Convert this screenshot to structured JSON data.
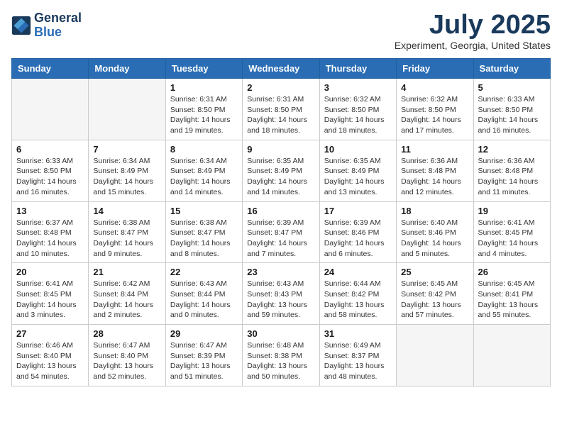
{
  "header": {
    "logo_line1": "General",
    "logo_line2": "Blue",
    "month": "July 2025",
    "location": "Experiment, Georgia, United States"
  },
  "days_of_week": [
    "Sunday",
    "Monday",
    "Tuesday",
    "Wednesday",
    "Thursday",
    "Friday",
    "Saturday"
  ],
  "weeks": [
    [
      {
        "day": "",
        "info": ""
      },
      {
        "day": "",
        "info": ""
      },
      {
        "day": "1",
        "sunrise": "6:31 AM",
        "sunset": "8:50 PM",
        "daylight": "14 hours and 19 minutes."
      },
      {
        "day": "2",
        "sunrise": "6:31 AM",
        "sunset": "8:50 PM",
        "daylight": "14 hours and 18 minutes."
      },
      {
        "day": "3",
        "sunrise": "6:32 AM",
        "sunset": "8:50 PM",
        "daylight": "14 hours and 18 minutes."
      },
      {
        "day": "4",
        "sunrise": "6:32 AM",
        "sunset": "8:50 PM",
        "daylight": "14 hours and 17 minutes."
      },
      {
        "day": "5",
        "sunrise": "6:33 AM",
        "sunset": "8:50 PM",
        "daylight": "14 hours and 16 minutes."
      }
    ],
    [
      {
        "day": "6",
        "sunrise": "6:33 AM",
        "sunset": "8:50 PM",
        "daylight": "14 hours and 16 minutes."
      },
      {
        "day": "7",
        "sunrise": "6:34 AM",
        "sunset": "8:49 PM",
        "daylight": "14 hours and 15 minutes."
      },
      {
        "day": "8",
        "sunrise": "6:34 AM",
        "sunset": "8:49 PM",
        "daylight": "14 hours and 14 minutes."
      },
      {
        "day": "9",
        "sunrise": "6:35 AM",
        "sunset": "8:49 PM",
        "daylight": "14 hours and 14 minutes."
      },
      {
        "day": "10",
        "sunrise": "6:35 AM",
        "sunset": "8:49 PM",
        "daylight": "14 hours and 13 minutes."
      },
      {
        "day": "11",
        "sunrise": "6:36 AM",
        "sunset": "8:48 PM",
        "daylight": "14 hours and 12 minutes."
      },
      {
        "day": "12",
        "sunrise": "6:36 AM",
        "sunset": "8:48 PM",
        "daylight": "14 hours and 11 minutes."
      }
    ],
    [
      {
        "day": "13",
        "sunrise": "6:37 AM",
        "sunset": "8:48 PM",
        "daylight": "14 hours and 10 minutes."
      },
      {
        "day": "14",
        "sunrise": "6:38 AM",
        "sunset": "8:47 PM",
        "daylight": "14 hours and 9 minutes."
      },
      {
        "day": "15",
        "sunrise": "6:38 AM",
        "sunset": "8:47 PM",
        "daylight": "14 hours and 8 minutes."
      },
      {
        "day": "16",
        "sunrise": "6:39 AM",
        "sunset": "8:47 PM",
        "daylight": "14 hours and 7 minutes."
      },
      {
        "day": "17",
        "sunrise": "6:39 AM",
        "sunset": "8:46 PM",
        "daylight": "14 hours and 6 minutes."
      },
      {
        "day": "18",
        "sunrise": "6:40 AM",
        "sunset": "8:46 PM",
        "daylight": "14 hours and 5 minutes."
      },
      {
        "day": "19",
        "sunrise": "6:41 AM",
        "sunset": "8:45 PM",
        "daylight": "14 hours and 4 minutes."
      }
    ],
    [
      {
        "day": "20",
        "sunrise": "6:41 AM",
        "sunset": "8:45 PM",
        "daylight": "14 hours and 3 minutes."
      },
      {
        "day": "21",
        "sunrise": "6:42 AM",
        "sunset": "8:44 PM",
        "daylight": "14 hours and 2 minutes."
      },
      {
        "day": "22",
        "sunrise": "6:43 AM",
        "sunset": "8:44 PM",
        "daylight": "14 hours and 0 minutes."
      },
      {
        "day": "23",
        "sunrise": "6:43 AM",
        "sunset": "8:43 PM",
        "daylight": "13 hours and 59 minutes."
      },
      {
        "day": "24",
        "sunrise": "6:44 AM",
        "sunset": "8:42 PM",
        "daylight": "13 hours and 58 minutes."
      },
      {
        "day": "25",
        "sunrise": "6:45 AM",
        "sunset": "8:42 PM",
        "daylight": "13 hours and 57 minutes."
      },
      {
        "day": "26",
        "sunrise": "6:45 AM",
        "sunset": "8:41 PM",
        "daylight": "13 hours and 55 minutes."
      }
    ],
    [
      {
        "day": "27",
        "sunrise": "6:46 AM",
        "sunset": "8:40 PM",
        "daylight": "13 hours and 54 minutes."
      },
      {
        "day": "28",
        "sunrise": "6:47 AM",
        "sunset": "8:40 PM",
        "daylight": "13 hours and 52 minutes."
      },
      {
        "day": "29",
        "sunrise": "6:47 AM",
        "sunset": "8:39 PM",
        "daylight": "13 hours and 51 minutes."
      },
      {
        "day": "30",
        "sunrise": "6:48 AM",
        "sunset": "8:38 PM",
        "daylight": "13 hours and 50 minutes."
      },
      {
        "day": "31",
        "sunrise": "6:49 AM",
        "sunset": "8:37 PM",
        "daylight": "13 hours and 48 minutes."
      },
      {
        "day": "",
        "info": ""
      },
      {
        "day": "",
        "info": ""
      }
    ]
  ]
}
